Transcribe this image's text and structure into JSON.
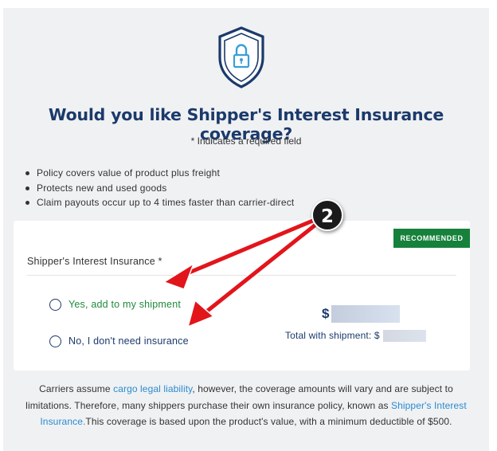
{
  "header": {
    "shield_icon": "shield-lock-icon",
    "title": "Would you like Shipper's Interest Insurance coverage?",
    "required_note": "* Indicates a required field"
  },
  "benefits": [
    "Policy covers value of product plus freight",
    "Protects new and used goods",
    "Claim payouts occur up to 4 times faster than carrier-direct"
  ],
  "card": {
    "badge": "RECOMMENDED",
    "label": "Shipper's Interest Insurance *",
    "options": [
      {
        "label": "Yes, add to my shipment",
        "selected": false
      },
      {
        "label": "No, I don't need insurance",
        "selected": false
      }
    ],
    "price_symbol": "$",
    "total_label": "Total with shipment: $"
  },
  "footer": {
    "part1": "Carriers assume ",
    "link1": "cargo legal liability",
    "part2": ", however, the coverage amounts will vary and are subject to limitations. Therefore, many shippers purchase their own insurance policy, known as ",
    "link2": "Shipper's Interest Insurance.",
    "part3": "This coverage is based upon the product's value, with a minimum deductible of $500."
  },
  "annotation": {
    "step_number": "2"
  },
  "colors": {
    "navy": "#1b3a6b",
    "green": "#16813b",
    "option_green": "#1f8a3c",
    "link": "#2a8bd0",
    "arrow_red": "#e2151b",
    "panel_bg": "#f0f1f3"
  }
}
